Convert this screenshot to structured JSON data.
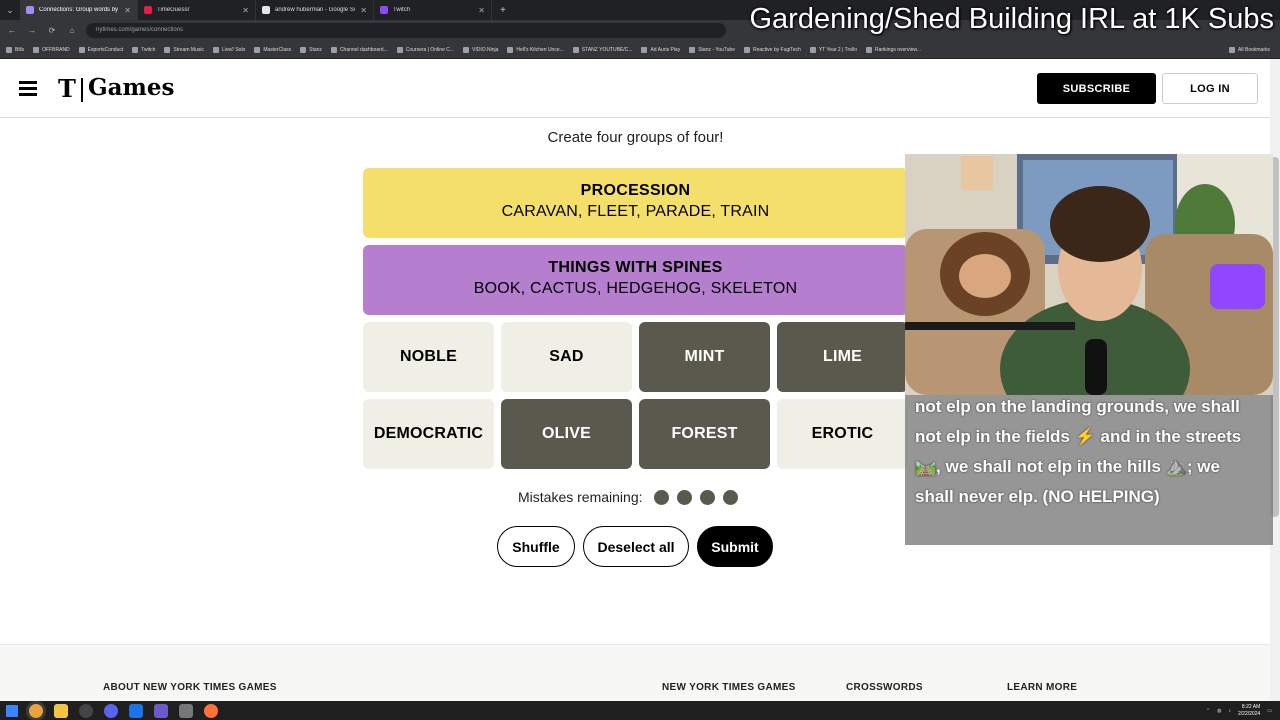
{
  "stream": {
    "overlay_title": "Gardening/Shed Building IRL at 1K Subs"
  },
  "browser": {
    "tabs": [
      {
        "label": "Connections: Group words by t",
        "color": "#a78bfa"
      },
      {
        "label": "TimeGuessr",
        "color": "#e11d48"
      },
      {
        "label": "andrew huberman - Google Sc",
        "color": "#e5e7eb"
      },
      {
        "label": "Twitch",
        "color": "#9146ff"
      }
    ],
    "url": "nytimes.com/games/connections",
    "bookmarks": [
      "Bills",
      "OFFBRAND",
      "EsportsConduct",
      "Twitch",
      "Stream Music",
      "Live// Solo",
      "MasterClass",
      "Stanz",
      "Channel dashboard...",
      "Coursera | Online C...",
      "VIDIO.Ninja",
      "Hell's Kitchen Unce...",
      "STANZ YOUTUBE/C...",
      "Ad Auris Play",
      "Stanz - YouTube",
      "Reactive by FugiTech",
      "YT Year 2 | Trello",
      "Rankings overview..."
    ],
    "all_bookmarks": "All Bookmarks"
  },
  "header": {
    "logo_t": "T",
    "logo_games": "Games",
    "subscribe": "SUBSCRIBE",
    "login": "LOG IN"
  },
  "game": {
    "subtitle": "Create four groups of four!",
    "solved": [
      {
        "category": "PROCESSION",
        "words": "CARAVAN, FLEET, PARADE, TRAIN",
        "color": "#f5df6b"
      },
      {
        "category": "THINGS WITH SPINES",
        "words": "BOOK, CACTUS, HEDGEHOG, SKELETON",
        "color": "#b57ecf"
      }
    ],
    "tiles": [
      {
        "word": "NOBLE",
        "selected": false
      },
      {
        "word": "SAD",
        "selected": false
      },
      {
        "word": "MINT",
        "selected": true
      },
      {
        "word": "LIME",
        "selected": true
      },
      {
        "word": "DEMOCRATIC",
        "selected": false
      },
      {
        "word": "OLIVE",
        "selected": true
      },
      {
        "word": "FOREST",
        "selected": true
      },
      {
        "word": "EROTIC",
        "selected": false
      }
    ],
    "mistakes_label": "Mistakes remaining:",
    "mistakes_remaining": 4,
    "buttons": {
      "shuffle": "Shuffle",
      "deselect": "Deselect all",
      "submit": "Submit"
    }
  },
  "footer": {
    "headings": [
      "ABOUT NEW YORK TIMES GAMES",
      "NEW YORK TIMES GAMES",
      "CROSSWORDS",
      "LEARN MORE"
    ]
  },
  "chat": {
    "message": "not elp on the landing grounds, we shall not elp in the fields ⚡ and in the streets🛤️, we shall not elp in the hills ⛰️; we shall never elp. (NO HELPING)"
  },
  "taskbar": {
    "time": "8:22 AM",
    "date": "2/22/2024"
  }
}
